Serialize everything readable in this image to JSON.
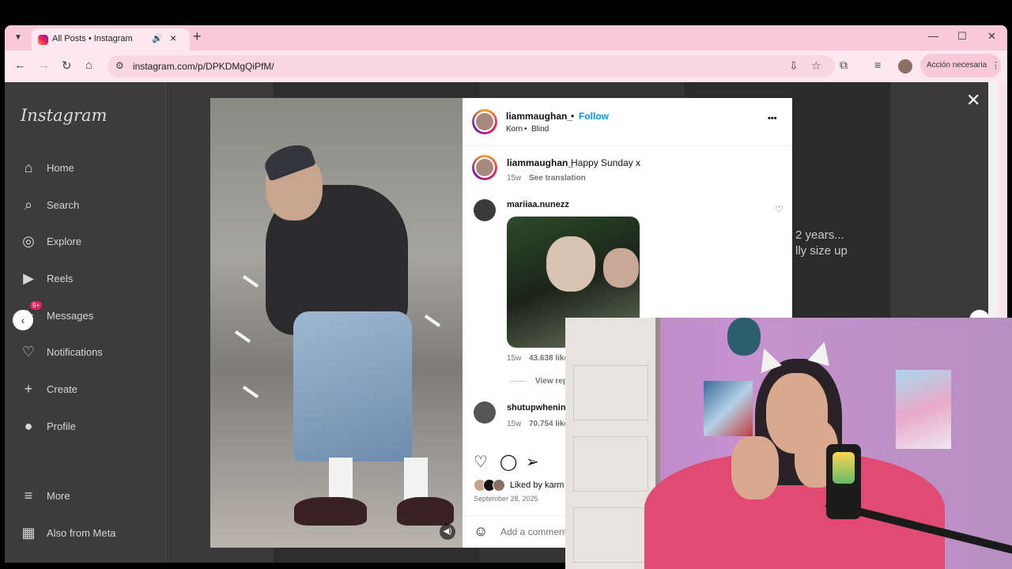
{
  "browser": {
    "tab_title": "All Posts • Instagram",
    "new_tab": "+",
    "url": "instagram.com/p/DPKDMgQiPfM/",
    "action_chip": "Acción necesaria",
    "minimize": "—",
    "maximize": "☐",
    "close": "✕"
  },
  "sidebar": {
    "logo": "Instagram",
    "items": [
      {
        "label": "Home",
        "icon": "⌂"
      },
      {
        "label": "Search",
        "icon": "⌕"
      },
      {
        "label": "Explore",
        "icon": "◎"
      },
      {
        "label": "Reels",
        "icon": "▶"
      },
      {
        "label": "Messages",
        "icon": "✈",
        "badge": "9+"
      },
      {
        "label": "Notifications",
        "icon": "♡"
      },
      {
        "label": "Create",
        "icon": "+"
      },
      {
        "label": "Profile",
        "icon": "●"
      },
      {
        "label": "More",
        "icon": "≡"
      },
      {
        "label": "Also from Meta",
        "icon": "▦"
      }
    ]
  },
  "background_text": {
    "line1": "2 years...",
    "line2": "lly size up"
  },
  "post": {
    "author": "liammaughan_",
    "follow": "Follow",
    "audio_artist": "Korn",
    "audio_song": "Blind",
    "more": "•••",
    "caption": "Happy Sunday x",
    "caption_age": "15w",
    "see_translation": "See translation",
    "comments": [
      {
        "user": "mariiaa.nunezz",
        "age": "15w",
        "likes": "43.638 like",
        "view_replies": "View rep"
      },
      {
        "user": "shutupwhenin",
        "age": "15w",
        "likes": "70.754 like"
      }
    ],
    "liked_by": "Liked by karm",
    "date": "September 28, 2025",
    "add_comment": "Add a comment"
  }
}
